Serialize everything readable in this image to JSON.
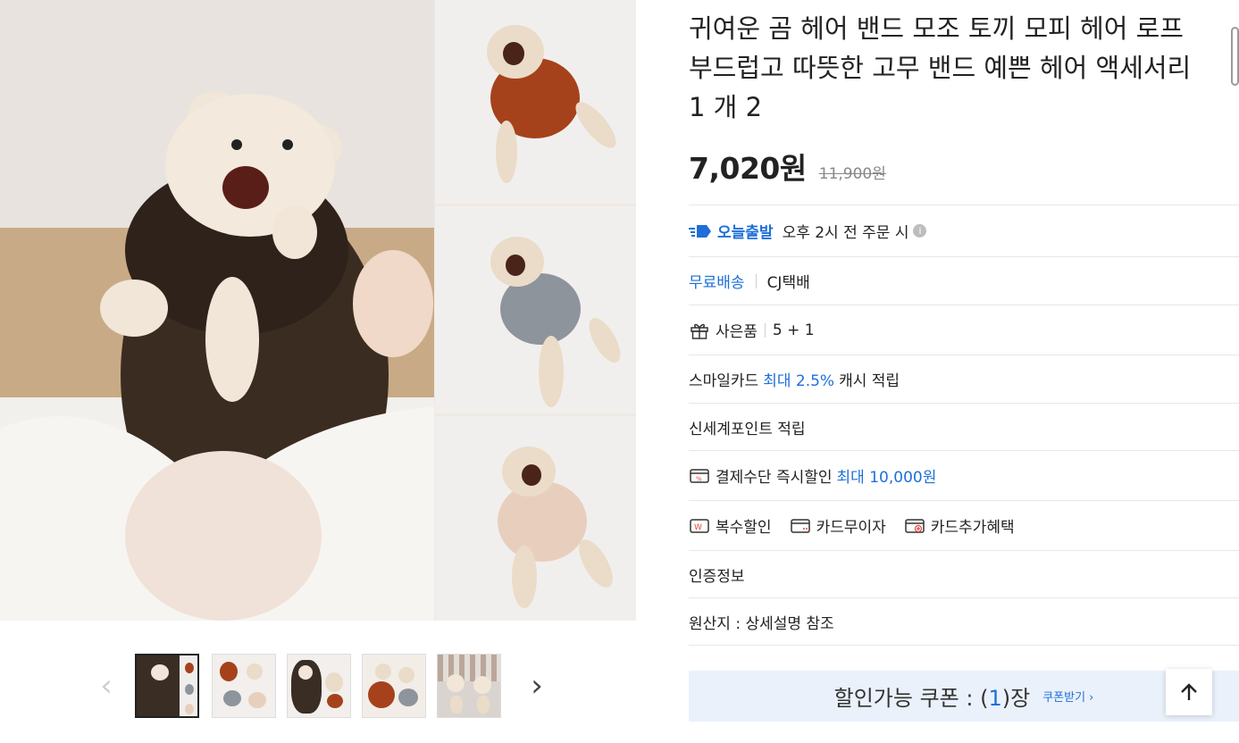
{
  "product": {
    "title": "귀여운 곰 헤어 밴드 모조 토끼 모피 헤어 로프 부드럽고 따뜻한 고무 밴드 예쁜 헤어 액세서리 1 개 2",
    "sale_price": "7,020원",
    "original_price": "11,900원"
  },
  "delivery": {
    "today_label": "오늘출발",
    "today_desc": "오후 2시 전 주문 시",
    "free_shipping": "무료배송",
    "carrier": "CJ택배"
  },
  "gift": {
    "label": "사은품",
    "value": "5 + 1"
  },
  "smile_card": {
    "prefix": "스마일카드",
    "highlight": "최대 2.5%",
    "suffix": "캐시 적립"
  },
  "shinsegae_point": "신세계포인트 적립",
  "payment_discount": {
    "label": "결제수단 즉시할인",
    "highlight": "최대 10,000원"
  },
  "card_benefits": [
    "복수할인",
    "카드무이자",
    "카드추가혜택"
  ],
  "certification": "인증정보",
  "origin": "원산지 : 상세설명 참조",
  "coupon": {
    "prefix": "할인가능 쿠폰 : (",
    "count": "1",
    "suffix": ")장",
    "link": "쿠폰받기 ›"
  },
  "icons": {
    "prev": "chevron-left-icon",
    "next": "chevron-right-icon",
    "top": "arrow-up-icon"
  },
  "colors": {
    "accent": "#1e6fd9",
    "coupon_bg": "#eaf1fb"
  },
  "gallery": {
    "thumbnail_count": 5,
    "active_thumbnail": 1
  }
}
